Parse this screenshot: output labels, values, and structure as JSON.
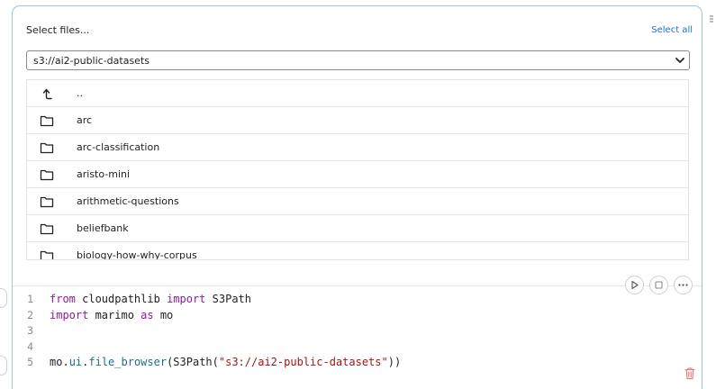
{
  "header": {
    "title": "Select files...",
    "select_all": "Select all"
  },
  "path_select": {
    "value": "s3://ai2-public-datasets"
  },
  "file_list": [
    {
      "icon": "arrow-up-icon",
      "name": ".."
    },
    {
      "icon": "folder-icon",
      "name": "arc"
    },
    {
      "icon": "folder-icon",
      "name": "arc-classification"
    },
    {
      "icon": "folder-icon",
      "name": "aristo-mini"
    },
    {
      "icon": "folder-icon",
      "name": "arithmetic-questions"
    },
    {
      "icon": "folder-icon",
      "name": "beliefbank"
    },
    {
      "icon": "folder-icon",
      "name": "biology-how-why-corpus"
    }
  ],
  "editor": {
    "lines": [
      {
        "n": "1",
        "t": [
          [
            "kw",
            "from"
          ],
          [
            "",
            " cloudpathlib "
          ],
          [
            "kw",
            "import"
          ],
          [
            "",
            " S3Path"
          ]
        ]
      },
      {
        "n": "2",
        "t": [
          [
            "kw",
            "import"
          ],
          [
            "",
            " marimo "
          ],
          [
            "kw",
            "as"
          ],
          [
            "",
            " mo"
          ]
        ]
      },
      {
        "n": "3",
        "t": []
      },
      {
        "n": "4",
        "t": []
      },
      {
        "n": "5",
        "t": [
          [
            "",
            "mo"
          ],
          [
            "",
            "."
          ],
          [
            "attr",
            "ui"
          ],
          [
            "",
            "."
          ],
          [
            "attr",
            "file_browser"
          ],
          [
            "",
            "(S3Path("
          ],
          [
            "str",
            "\"s3://ai2-public-datasets\""
          ],
          [
            "",
            "))"
          ]
        ]
      }
    ]
  },
  "colors": {
    "cell_border": "#9ec4e4",
    "link": "#1d6fc9",
    "keyword": "#8a1c9c",
    "string": "#a31515",
    "delete": "#e57373"
  }
}
